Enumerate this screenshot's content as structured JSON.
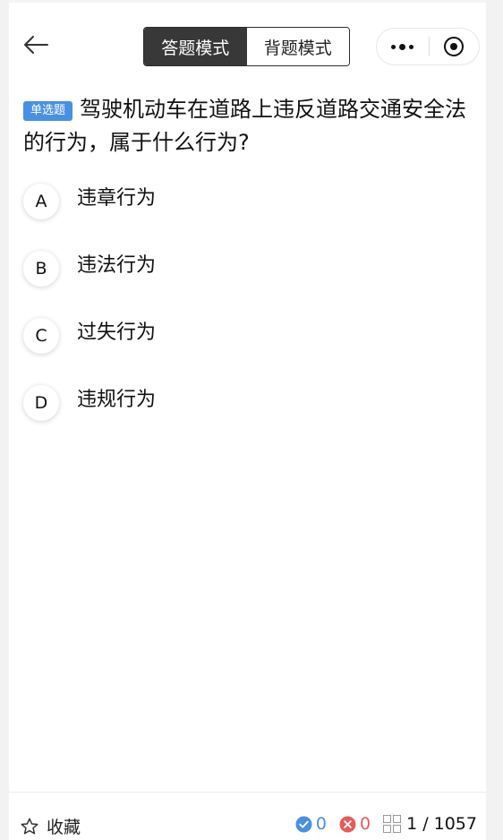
{
  "nav": {
    "modes": [
      {
        "label": "答题模式",
        "active": true
      },
      {
        "label": "背题模式",
        "active": false
      }
    ]
  },
  "question": {
    "type_badge": "单选题",
    "text": "驾驶机动车在道路上违反道路交通安全法的行为，属于什么行为?"
  },
  "options": [
    {
      "letter": "A",
      "text": "违章行为"
    },
    {
      "letter": "B",
      "text": "违法行为"
    },
    {
      "letter": "C",
      "text": "过失行为"
    },
    {
      "letter": "D",
      "text": "违规行为"
    }
  ],
  "footer": {
    "favorite_label": "收藏",
    "correct_count": "0",
    "wrong_count": "0",
    "progress": "1 / 1057"
  },
  "colors": {
    "accent": "#4a90e2",
    "error": "#e85a5a",
    "active_mode_bg": "#383838"
  }
}
